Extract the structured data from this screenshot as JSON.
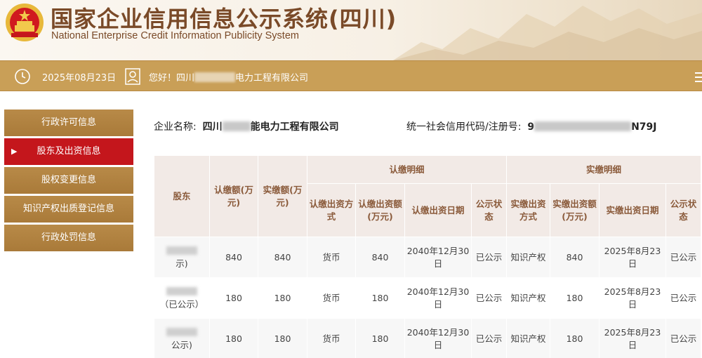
{
  "header": {
    "title_cn": "国家企业信用信息公示系统(四川)",
    "title_en": "National Enterprise Credit Information Publicity System"
  },
  "infobar": {
    "date": "2025年08月23日",
    "greeting_prefix": "您好！四川",
    "greeting_suffix": "电力工程有限公司"
  },
  "sidebar": {
    "items": [
      {
        "label": "行政许可信息",
        "active": false
      },
      {
        "label": "股东及出资信息",
        "active": true
      },
      {
        "label": "股权变更信息",
        "active": false
      },
      {
        "label": "知识产权出质登记信息",
        "active": false
      },
      {
        "label": "行政处罚信息",
        "active": false
      }
    ]
  },
  "company": {
    "name_label": "企业名称:",
    "name_prefix": "四川",
    "name_suffix": "能电力工程有限公司",
    "code_label": "统一社会信用代码/注册号:",
    "code_prefix": "9",
    "code_suffix": "N79J"
  },
  "table": {
    "headers": {
      "shareholder": "股东",
      "subscribed_amount": "认缴额(万元)",
      "paid_amount": "实缴额(万元)",
      "subscribed_detail": "认缴明细",
      "paid_detail": "实缴明细",
      "sub_method": "认缴出资方式",
      "sub_amount": "认缴出资额(万元)",
      "sub_date": "认缴出资日期",
      "sub_status": "公示状态",
      "paid_method": "实缴出资方式",
      "paid_amt": "实缴出资额(万元)",
      "paid_date": "实缴出资日期",
      "paid_status": "公示状态"
    },
    "rows": [
      {
        "shareholder_suffix": "示)",
        "subscribed": "840",
        "paid": "840",
        "sub_method": "货币",
        "sub_amount": "840",
        "sub_date": "2040年12月30日",
        "sub_status": "已公示",
        "paid_method": "知识产权",
        "paid_amount": "840",
        "paid_date": "2025年8月23日",
        "paid_status": "已公示"
      },
      {
        "shareholder_suffix": "（已公示）",
        "subscribed": "180",
        "paid": "180",
        "sub_method": "货币",
        "sub_amount": "180",
        "sub_date": "2040年12月30日",
        "sub_status": "已公示",
        "paid_method": "知识产权",
        "paid_amount": "180",
        "paid_date": "2025年8月23日",
        "paid_status": "已公示"
      },
      {
        "shareholder_suffix": "公示)",
        "subscribed": "180",
        "paid": "180",
        "sub_method": "货币",
        "sub_amount": "180",
        "sub_date": "2040年12月30日",
        "sub_status": "已公示",
        "paid_method": "知识产权",
        "paid_amount": "180",
        "paid_date": "2025年8月23日",
        "paid_status": "已公示"
      }
    ]
  },
  "colors": {
    "brand_brown": "#7a4a28",
    "bar_gold": "#c99f57",
    "active_red": "#c4161c",
    "header_cell": "#f2eae6"
  }
}
